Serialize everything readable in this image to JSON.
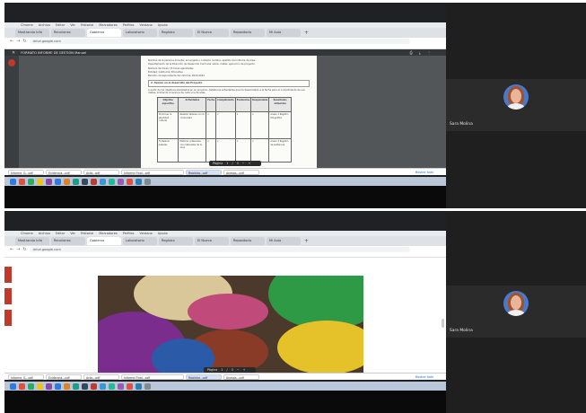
{
  "browser": {
    "menu": [
      "Chrome",
      "Archivo",
      "Editar",
      "Ver",
      "Historial",
      "Marcadores",
      "Perfiles",
      "Ventana",
      "Ayuda"
    ],
    "tabs": [
      "Mostrando Info",
      "Reuniones",
      "Gobierno",
      "Laboratorio",
      "Registro",
      "El Nuevo",
      "Repositorio",
      "Mi Aula"
    ],
    "new_tab_symbol": "+",
    "url": "drive.google.com",
    "pdf_title": "FORMATO INFORME DE GESTIÓN Manuel"
  },
  "document": {
    "intro_lines": [
      "Nombre de la persona docente, encargada o contacto nombre, apellido del informe de área.",
      "Departamento de la Dirección de Desarrollo Curricular sobre, metas, ejecución de proyecto.",
      "Número de horas: 15 horas ejecutadas",
      "Entidad: Institución Educativa",
      "Periodo correspondiente del informe: 2020-2021"
    ],
    "section_heading": "2. Avance en el desarrollo del Proyecto",
    "section_text": "A partir de los objetivos planteados en su proyecto, detalle las actividades que ha desarrollado a la fecha para el cumplimiento de sus metas, indicando el avance de cada una de ellas.",
    "table": {
      "headers": [
        "Objetivo específico",
        "Actividades",
        "Fecha",
        "Cumplimiento",
        "Evidencias",
        "Responsable",
        "Resultados obtenidos"
      ],
      "rows": [
        [
          "Promover la identidad cultural",
          "Realizar talleres con la comunidad",
          "x",
          "x",
          "x",
          "x",
          "Anexo 1 Registro fotográfico"
        ],
        [
          "Fortalecer saberes",
          "Elaborar artesanías con materiales de la zona",
          "x",
          "x",
          "x",
          "x",
          "Anexo 2 Registro de asistencia"
        ]
      ]
    },
    "page_toolbar": [
      "Página",
      "1",
      "/",
      "3",
      "−",
      "+"
    ]
  },
  "downloads": [
    "Informe_G...pdf",
    "Evidencia...pdf",
    "Acta...pdf",
    "Informe Final...pdf",
    "Registro...pdf",
    "Anexos...pdf"
  ],
  "downloads_show_all": "Mostrar todo",
  "participant": {
    "name": "Sara Molina"
  },
  "colors": {
    "avatar_bg": "#4a79c9",
    "pdf_toolbar": "#323639",
    "taskbar": "#b9c7d8"
  }
}
